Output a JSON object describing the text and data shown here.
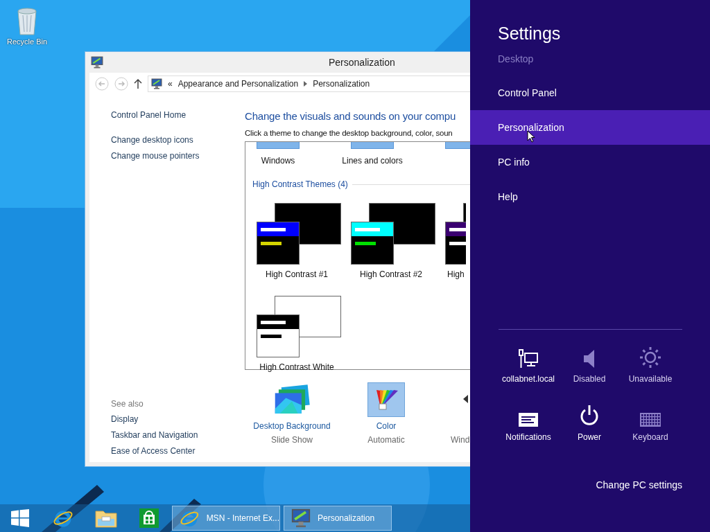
{
  "desktop_icons": [
    {
      "label": "Recycle Bin"
    }
  ],
  "window": {
    "title": "Personalization",
    "address": {
      "prefix": "«",
      "path": [
        "Appearance and Personalization",
        "Personalization"
      ]
    },
    "sidebar": {
      "links": [
        "Control Panel Home",
        "Change desktop icons",
        "Change mouse pointers"
      ],
      "see_also_label": "See also",
      "see_also": [
        "Display",
        "Taskbar and Navigation",
        "Ease of Access Center"
      ]
    },
    "heading": "Change the visuals and sounds on your compu",
    "description": "Click a theme to change the desktop background, color, soun",
    "themes_top": [
      {
        "label": "Windows"
      },
      {
        "label": "Lines and colors"
      }
    ],
    "group_label": "High Contrast Themes (4)",
    "high_contrast": [
      {
        "label": "High Contrast #1",
        "dark": true,
        "cut": false,
        "bars": [
          {
            "color": "#0000ff"
          },
          {
            "color": "#d4d400"
          }
        ]
      },
      {
        "label": "High Contrast #2",
        "dark": true,
        "cut": false,
        "bars": [
          {
            "color": "#00ffff"
          },
          {
            "color": "#00e000"
          }
        ]
      },
      {
        "label": "High",
        "dark": true,
        "cut": true,
        "bars": [
          {
            "color": "#3a0070"
          },
          {
            "color": "#ffffff"
          }
        ]
      },
      {
        "label": "High Contrast White",
        "dark": false,
        "cut": false,
        "bars": [
          {
            "color": "#000000"
          },
          {
            "color": "#000000"
          }
        ]
      }
    ],
    "settings": [
      {
        "kind": "background",
        "title": "Desktop Background",
        "value": "Slide Show",
        "selected": false
      },
      {
        "kind": "color",
        "title": "Color",
        "value": "Automatic",
        "selected": true
      },
      {
        "kind": "sound",
        "value": "Wind",
        "selected": false
      }
    ]
  },
  "charms": {
    "title": "Settings",
    "subtitle": "Desktop",
    "items": [
      {
        "label": "Control Panel",
        "selected": false
      },
      {
        "label": "Personalization",
        "selected": true
      },
      {
        "label": "PC info",
        "selected": false
      },
      {
        "label": "Help",
        "selected": false
      }
    ],
    "quick": [
      {
        "kind": "network",
        "label": "collabnet.local",
        "disabled": false
      },
      {
        "kind": "volume",
        "label": "Disabled",
        "disabled": true
      },
      {
        "kind": "brightness",
        "label": "Unavailable",
        "disabled": true
      },
      {
        "kind": "notifications",
        "label": "Notifications",
        "disabled": false
      },
      {
        "kind": "power",
        "label": "Power",
        "disabled": false
      },
      {
        "kind": "keyboard",
        "label": "Keyboard",
        "disabled": true
      }
    ],
    "footer": "Change PC settings"
  },
  "taskbar": {
    "pinned": [
      {
        "kind": "start"
      },
      {
        "kind": "ie"
      },
      {
        "kind": "explorer"
      },
      {
        "kind": "store"
      }
    ],
    "tasks": [
      {
        "kind": "ie",
        "label": "MSN - Internet Ex..."
      },
      {
        "kind": "personalization",
        "label": "Personalization"
      }
    ]
  }
}
